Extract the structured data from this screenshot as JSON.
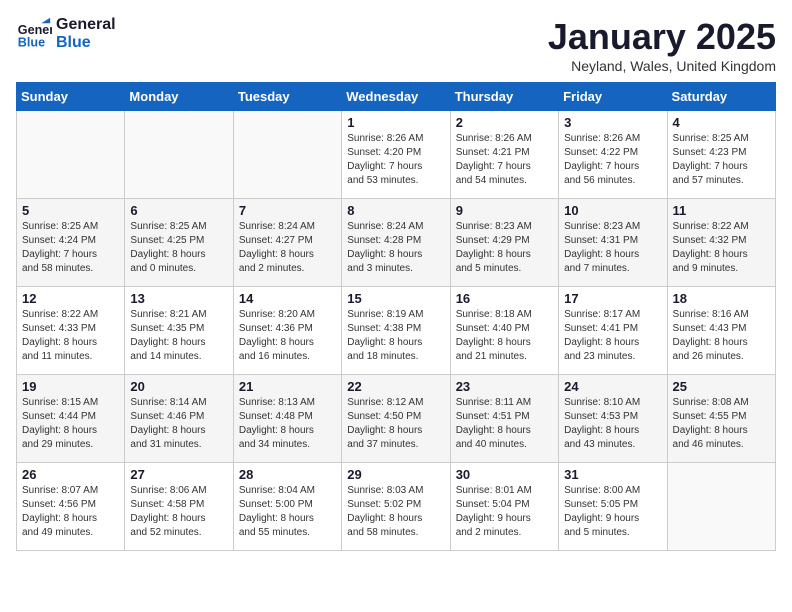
{
  "header": {
    "logo_line1": "General",
    "logo_line2": "Blue",
    "title": "January 2025",
    "subtitle": "Neyland, Wales, United Kingdom"
  },
  "days_of_week": [
    "Sunday",
    "Monday",
    "Tuesday",
    "Wednesday",
    "Thursday",
    "Friday",
    "Saturday"
  ],
  "weeks": [
    [
      {
        "day": "",
        "info": ""
      },
      {
        "day": "",
        "info": ""
      },
      {
        "day": "",
        "info": ""
      },
      {
        "day": "1",
        "info": "Sunrise: 8:26 AM\nSunset: 4:20 PM\nDaylight: 7 hours\nand 53 minutes."
      },
      {
        "day": "2",
        "info": "Sunrise: 8:26 AM\nSunset: 4:21 PM\nDaylight: 7 hours\nand 54 minutes."
      },
      {
        "day": "3",
        "info": "Sunrise: 8:26 AM\nSunset: 4:22 PM\nDaylight: 7 hours\nand 56 minutes."
      },
      {
        "day": "4",
        "info": "Sunrise: 8:25 AM\nSunset: 4:23 PM\nDaylight: 7 hours\nand 57 minutes."
      }
    ],
    [
      {
        "day": "5",
        "info": "Sunrise: 8:25 AM\nSunset: 4:24 PM\nDaylight: 7 hours\nand 58 minutes."
      },
      {
        "day": "6",
        "info": "Sunrise: 8:25 AM\nSunset: 4:25 PM\nDaylight: 8 hours\nand 0 minutes."
      },
      {
        "day": "7",
        "info": "Sunrise: 8:24 AM\nSunset: 4:27 PM\nDaylight: 8 hours\nand 2 minutes."
      },
      {
        "day": "8",
        "info": "Sunrise: 8:24 AM\nSunset: 4:28 PM\nDaylight: 8 hours\nand 3 minutes."
      },
      {
        "day": "9",
        "info": "Sunrise: 8:23 AM\nSunset: 4:29 PM\nDaylight: 8 hours\nand 5 minutes."
      },
      {
        "day": "10",
        "info": "Sunrise: 8:23 AM\nSunset: 4:31 PM\nDaylight: 8 hours\nand 7 minutes."
      },
      {
        "day": "11",
        "info": "Sunrise: 8:22 AM\nSunset: 4:32 PM\nDaylight: 8 hours\nand 9 minutes."
      }
    ],
    [
      {
        "day": "12",
        "info": "Sunrise: 8:22 AM\nSunset: 4:33 PM\nDaylight: 8 hours\nand 11 minutes."
      },
      {
        "day": "13",
        "info": "Sunrise: 8:21 AM\nSunset: 4:35 PM\nDaylight: 8 hours\nand 14 minutes."
      },
      {
        "day": "14",
        "info": "Sunrise: 8:20 AM\nSunset: 4:36 PM\nDaylight: 8 hours\nand 16 minutes."
      },
      {
        "day": "15",
        "info": "Sunrise: 8:19 AM\nSunset: 4:38 PM\nDaylight: 8 hours\nand 18 minutes."
      },
      {
        "day": "16",
        "info": "Sunrise: 8:18 AM\nSunset: 4:40 PM\nDaylight: 8 hours\nand 21 minutes."
      },
      {
        "day": "17",
        "info": "Sunrise: 8:17 AM\nSunset: 4:41 PM\nDaylight: 8 hours\nand 23 minutes."
      },
      {
        "day": "18",
        "info": "Sunrise: 8:16 AM\nSunset: 4:43 PM\nDaylight: 8 hours\nand 26 minutes."
      }
    ],
    [
      {
        "day": "19",
        "info": "Sunrise: 8:15 AM\nSunset: 4:44 PM\nDaylight: 8 hours\nand 29 minutes."
      },
      {
        "day": "20",
        "info": "Sunrise: 8:14 AM\nSunset: 4:46 PM\nDaylight: 8 hours\nand 31 minutes."
      },
      {
        "day": "21",
        "info": "Sunrise: 8:13 AM\nSunset: 4:48 PM\nDaylight: 8 hours\nand 34 minutes."
      },
      {
        "day": "22",
        "info": "Sunrise: 8:12 AM\nSunset: 4:50 PM\nDaylight: 8 hours\nand 37 minutes."
      },
      {
        "day": "23",
        "info": "Sunrise: 8:11 AM\nSunset: 4:51 PM\nDaylight: 8 hours\nand 40 minutes."
      },
      {
        "day": "24",
        "info": "Sunrise: 8:10 AM\nSunset: 4:53 PM\nDaylight: 8 hours\nand 43 minutes."
      },
      {
        "day": "25",
        "info": "Sunrise: 8:08 AM\nSunset: 4:55 PM\nDaylight: 8 hours\nand 46 minutes."
      }
    ],
    [
      {
        "day": "26",
        "info": "Sunrise: 8:07 AM\nSunset: 4:56 PM\nDaylight: 8 hours\nand 49 minutes."
      },
      {
        "day": "27",
        "info": "Sunrise: 8:06 AM\nSunset: 4:58 PM\nDaylight: 8 hours\nand 52 minutes."
      },
      {
        "day": "28",
        "info": "Sunrise: 8:04 AM\nSunset: 5:00 PM\nDaylight: 8 hours\nand 55 minutes."
      },
      {
        "day": "29",
        "info": "Sunrise: 8:03 AM\nSunset: 5:02 PM\nDaylight: 8 hours\nand 58 minutes."
      },
      {
        "day": "30",
        "info": "Sunrise: 8:01 AM\nSunset: 5:04 PM\nDaylight: 9 hours\nand 2 minutes."
      },
      {
        "day": "31",
        "info": "Sunrise: 8:00 AM\nSunset: 5:05 PM\nDaylight: 9 hours\nand 5 minutes."
      },
      {
        "day": "",
        "info": ""
      }
    ]
  ]
}
